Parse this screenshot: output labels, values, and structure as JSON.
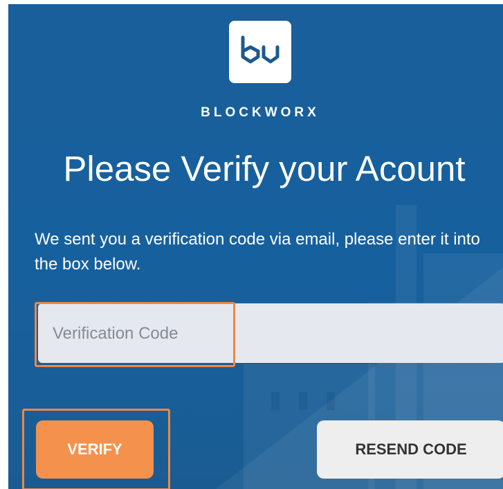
{
  "brand": {
    "name": "BLOCKWORX",
    "logo_icon": "blockworx-logo-icon"
  },
  "heading": "Please Verify your Acount",
  "message": "We sent you a verification code via email, please enter it into the box below.",
  "verification": {
    "value": "",
    "placeholder": "Verification Code"
  },
  "buttons": {
    "verify_label": "VERIFY",
    "resend_label": "RESEND CODE"
  },
  "colors": {
    "background": "#185f9b",
    "accent": "#f4914d",
    "highlight": "#ef8843",
    "input_background": "#e5e9ef",
    "secondary_button": "#eeeeee"
  }
}
